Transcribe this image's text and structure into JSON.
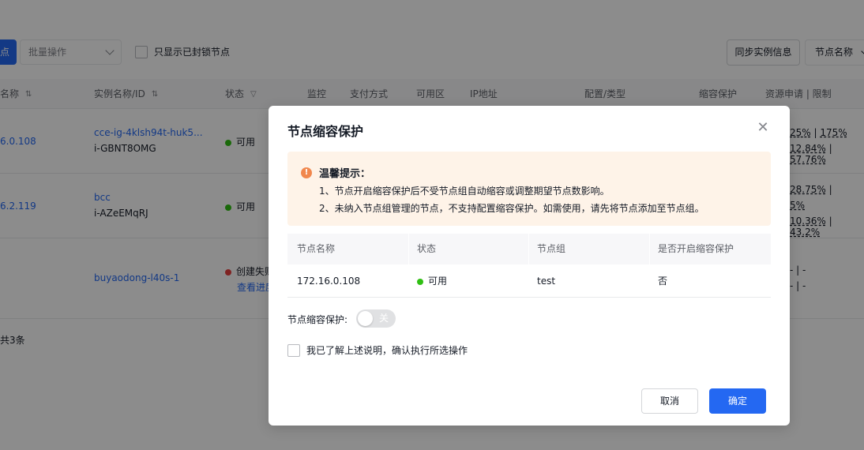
{
  "toolbar": {
    "primary_label_cut": "点",
    "batch_placeholder": "批量操作",
    "locked_only_label": "只显示已封锁节点",
    "sync_label": "同步实例信息",
    "name_filter_label": "节点名称"
  },
  "table": {
    "headers": [
      "名称",
      "实例名称/ID",
      "状态",
      "监控",
      "支付方式",
      "可用区",
      "IP地址",
      "配置/类型",
      "缩容保护",
      "资源申请 | 限制"
    ],
    "rows": [
      {
        "name": "6.0.108",
        "instance_name": "cce-ig-4klsh94t-huk5...",
        "instance_id": "i-GBNT8OMG",
        "status": "可用",
        "res_line1_a": "25%",
        "res_line1_b": "175%",
        "res_line2_a": "12.84%",
        "res_line2_b": "57.76%"
      },
      {
        "name": "6.2.119",
        "instance_name": "bcc",
        "instance_id": "i-AZeEMqRJ",
        "status": "可用",
        "res_line1_a": "28.75%",
        "res_line2_a": "5%",
        "res_line3_a": "10.36%",
        "res_line3_b": "43.2%"
      },
      {
        "instance_name": "buyaodong-l40s-1",
        "status": "创建失败",
        "status_link": "查看进度",
        "res_line1": "- | -",
        "res_line2": "- | -"
      }
    ],
    "total": "共3条"
  },
  "dialog": {
    "title": "节点缩容保护",
    "tip": {
      "title": "温馨提示：",
      "line1": "1、节点开启缩容保护后不受节点组自动缩容或调整期望节点数影响。",
      "line2": "2、未纳入节点组管理的节点，不支持配置缩容保护。如需使用，请先将节点添加至节点组。"
    },
    "table": {
      "headers": [
        "节点名称",
        "状态",
        "节点组",
        "是否开启缩容保护"
      ],
      "row": {
        "node_name": "172.16.0.108",
        "status": "可用",
        "node_group": "test",
        "protection": "否"
      }
    },
    "switch_label": "节点缩容保护:",
    "switch_state": "关",
    "confirm_label": "我已了解上述说明，确认执行所选操作",
    "cancel_label": "取消",
    "ok_label": "确定"
  },
  "colors": {
    "primary": "#2468f2",
    "available": "#30bf13",
    "failed": "#e8403f",
    "warning": "#f1874d"
  }
}
